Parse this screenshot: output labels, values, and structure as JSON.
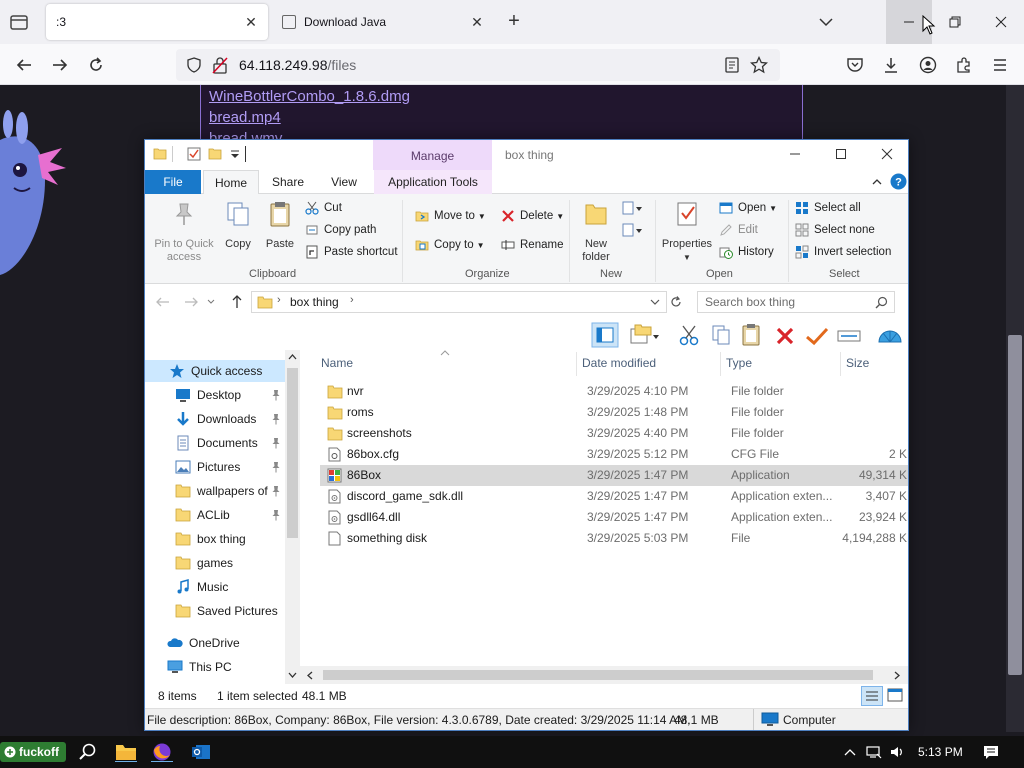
{
  "browser": {
    "tabs": [
      {
        "label": ":3",
        "active": true
      },
      {
        "label": "Download Java",
        "active": false
      }
    ],
    "url_host": "64.118.249.98",
    "url_path": "/files"
  },
  "webpage": {
    "links": [
      "WineBottlerCombo_1.8.6.dmg",
      "bread.mp4",
      "bread.wmv"
    ]
  },
  "explorer": {
    "title": "box thing",
    "manage_label": "Manage",
    "ribbon_tabs": [
      "File",
      "Home",
      "Share",
      "View",
      "Application Tools"
    ],
    "clipboard": {
      "pin_label": "Pin to Quick access",
      "copy_label": "Copy",
      "paste_label": "Paste",
      "cut_label": "Cut",
      "copy_path_label": "Copy path",
      "paste_shortcut_label": "Paste shortcut",
      "group_label": "Clipboard"
    },
    "organize": {
      "move_to_label": "Move to",
      "copy_to_label": "Copy to",
      "delete_label": "Delete",
      "rename_label": "Rename",
      "group_label": "Organize"
    },
    "new_group": {
      "new_folder_label": "New folder",
      "group_label": "New"
    },
    "open_group": {
      "properties_label": "Properties",
      "open_label": "Open",
      "edit_label": "Edit",
      "history_label": "History",
      "group_label": "Open"
    },
    "select_group": {
      "select_all_label": "Select all",
      "select_none_label": "Select none",
      "invert_label": "Invert selection",
      "group_label": "Select"
    },
    "address": {
      "crumb": "box thing",
      "search_placeholder": "Search box thing"
    },
    "nav_pane": [
      {
        "label": "Quick access",
        "icon": "star-icon",
        "pinned": false,
        "selected": true
      },
      {
        "label": "Desktop",
        "icon": "desktop-icon",
        "pinned": true
      },
      {
        "label": "Downloads",
        "icon": "download-icon",
        "pinned": true
      },
      {
        "label": "Documents",
        "icon": "documents-icon",
        "pinned": true
      },
      {
        "label": "Pictures",
        "icon": "pictures-icon",
        "pinned": true
      },
      {
        "label": "wallpapers of",
        "icon": "folder-icon",
        "pinned": true
      },
      {
        "label": "ACLib",
        "icon": "folder-icon",
        "pinned": true
      },
      {
        "label": "box thing",
        "icon": "folder-icon",
        "pinned": false
      },
      {
        "label": "games",
        "icon": "folder-icon",
        "pinned": false
      },
      {
        "label": "Music",
        "icon": "music-icon",
        "pinned": false
      },
      {
        "label": "Saved Pictures",
        "icon": "folder-icon",
        "pinned": false
      },
      {
        "label": "OneDrive",
        "icon": "cloud-icon",
        "pinned": false
      },
      {
        "label": "This PC",
        "icon": "computer-icon",
        "pinned": false
      }
    ],
    "columns": [
      "Name",
      "Date modified",
      "Type",
      "Size"
    ],
    "files": [
      {
        "name": "nvr",
        "date": "3/29/2025 4:10 PM",
        "type": "File folder",
        "size": "",
        "icon": "folder-icon"
      },
      {
        "name": "roms",
        "date": "3/29/2025 1:48 PM",
        "type": "File folder",
        "size": "",
        "icon": "folder-icon"
      },
      {
        "name": "screenshots",
        "date": "3/29/2025 4:40 PM",
        "type": "File folder",
        "size": "",
        "icon": "folder-icon"
      },
      {
        "name": "86box.cfg",
        "date": "3/29/2025 5:12 PM",
        "type": "CFG File",
        "size": "2 KB",
        "icon": "cfg-file-icon"
      },
      {
        "name": "86Box",
        "date": "3/29/2025 1:47 PM",
        "type": "Application",
        "size": "49,314 KB",
        "icon": "app-icon",
        "selected": true
      },
      {
        "name": "discord_game_sdk.dll",
        "date": "3/29/2025 1:47 PM",
        "type": "Application exten...",
        "size": "3,407 KB",
        "icon": "dll-icon"
      },
      {
        "name": "gsdll64.dll",
        "date": "3/29/2025 1:47 PM",
        "type": "Application exten...",
        "size": "23,924 KB",
        "icon": "dll-icon"
      },
      {
        "name": "something disk",
        "date": "3/29/2025 5:03 PM",
        "type": "File",
        "size": "4,194,288 KB",
        "icon": "file-icon"
      }
    ],
    "status": {
      "items": "8 items",
      "selected": "1 item selected",
      "size": "48.1 MB"
    },
    "details": {
      "text": "File description: 86Box, Company: 86Box, File version: 4.3.0.6789, Date created: 3/29/2025 11:14 AM,",
      "size": "48.1 MB",
      "location": "Computer"
    }
  },
  "taskbar": {
    "start_label": "fuckoff",
    "clock": "5:13 PM"
  }
}
